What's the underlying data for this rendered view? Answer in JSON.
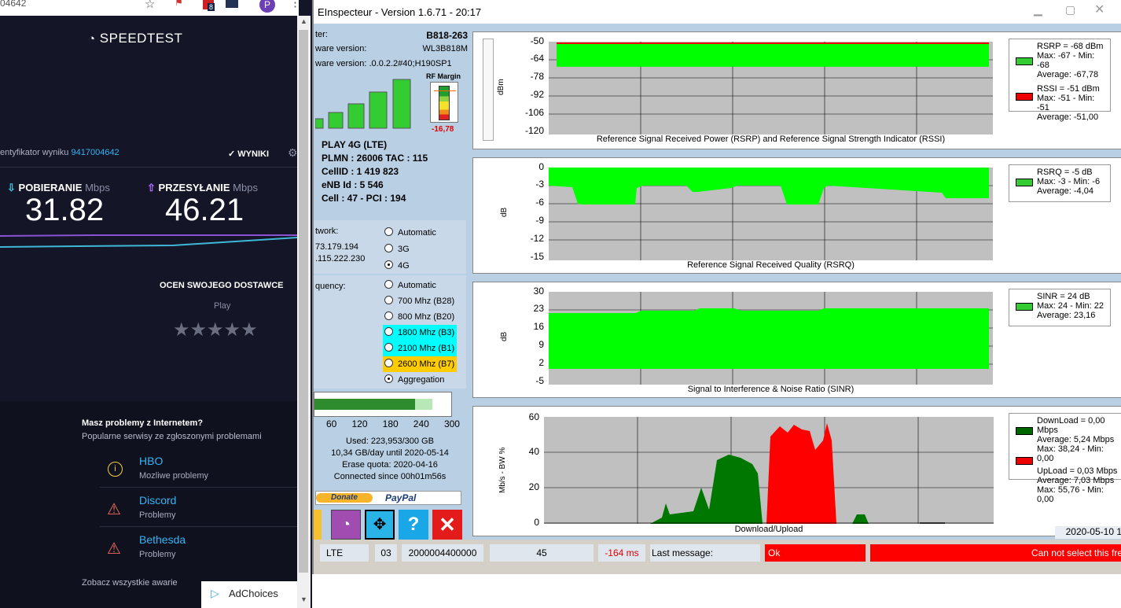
{
  "browser": {
    "url_fragment": "04642",
    "speedtest_logo": "SPEEDTEST",
    "result_id_label": "entyfikator wyniku",
    "result_id": "9417004642",
    "results_button": "WYNIKI",
    "download_label": "POBIERANIE",
    "download_unit": "Mbps",
    "download_value": "31.82",
    "upload_label": "PRZESYŁANIE",
    "upload_unit": "Mbps",
    "upload_value": "46.21",
    "rate_title": "OCEN SWOJEGO DOSTAWCE",
    "provider": "Play",
    "rating_stars": 0,
    "problems_title": "Masz problemy z Internetem?",
    "problems_subtitle": "Popularne serwisy ze zgłoszonymi problemami",
    "issues": [
      {
        "name": "HBO",
        "status": "Mozliwe problemy"
      },
      {
        "name": "Discord",
        "status": "Problemy"
      },
      {
        "name": "Bethesda",
        "status": "Problemy"
      }
    ],
    "see_all": "Zobacz wszystkie awarie",
    "adchoices": "AdChoices",
    "profile_initial": "P",
    "ext_badge": "8"
  },
  "app": {
    "title": "EInspecteur - Version 1.6.71 - 20:17",
    "router_label": "ter:",
    "router_value": "B818-263",
    "hw_label": "ware version:",
    "hw_value": "WL3B818M",
    "sw_label": "ware version:",
    "sw_value": ".0.0.2.2#40;H190SP1",
    "rf_margin_label": "RF Margin",
    "rf_margin_value": "-16,78",
    "net_lines": [
      "PLAY 4G (LTE)",
      "PLMN : 26006 TAC : 115",
      "CellID : 1 419 823",
      "eNB Id : 5 546",
      "Cell : 47 - PCI : 194"
    ],
    "network_label": "twork:",
    "ip1": "73.179.194",
    "ip2": ".115.222.230",
    "network_options": [
      "Automatic",
      "3G",
      "4G"
    ],
    "network_selected": 2,
    "freq_label": "quency:",
    "freq_options": [
      {
        "label": "Automatic",
        "bg": ""
      },
      {
        "label": "700 Mhz (B28)",
        "bg": ""
      },
      {
        "label": "800 Mhz (B20)",
        "bg": ""
      },
      {
        "label": "1800 Mhz (B3)",
        "bg": "#00ffff"
      },
      {
        "label": "2100 Mhz (B1)",
        "bg": "#00ffff"
      },
      {
        "label": "2600 Mhz (B7)",
        "bg": "#ffcc00"
      },
      {
        "label": "Aggregation",
        "bg": ""
      }
    ],
    "freq_selected": 6,
    "usage_ticks": [
      "60",
      "120",
      "180",
      "240",
      "300"
    ],
    "usage_fraction": 0.75,
    "used": "Used: 223,953/300 GB",
    "per_day": "10,34 GB/day until 2020-05-14",
    "erase": "Erase quota: 2020-04-16",
    "connected": "Connected since 00h01m56s",
    "donate": "Donate",
    "paypal": "PayPal",
    "charts": [
      {
        "title": "Reference Signal Received Power (RSRP) and Reference Signal Strength Indicator (RSSI)",
        "ylabel": "dBm",
        "yticks": [
          "-50",
          "-64",
          "-78",
          "-92",
          "-106",
          "-120"
        ],
        "legend": [
          {
            "color": "#33cc33",
            "lines": [
              "RSRP = -68 dBm",
              "Max: -67 - Min: -68",
              "Average: -67,78"
            ]
          },
          {
            "color": "#ee0000",
            "lines": [
              "RSSI = -51 dBm",
              "Max: -51 - Min: -51",
              "Average: -51,00"
            ]
          }
        ]
      },
      {
        "title": "Reference Signal Received Quality (RSRQ)",
        "ylabel": "dB",
        "yticks": [
          "0",
          "-3",
          "-6",
          "-9",
          "-12",
          "-15"
        ],
        "legend": [
          {
            "color": "#33cc33",
            "lines": [
              "RSRQ = -5 dB",
              "Max: -3 - Min: -6",
              "Average: -4,04"
            ]
          }
        ]
      },
      {
        "title": "Signal to Interference & Noise Ratio (SINR)",
        "ylabel": "dB",
        "yticks": [
          "30",
          "23",
          "16",
          "9",
          "2",
          "-5"
        ],
        "legend": [
          {
            "color": "#33cc33",
            "lines": [
              "SINR = 24 dB",
              "Max: 24 - Min: 22",
              "Average: 23,16"
            ]
          }
        ]
      },
      {
        "title": "Download/Upload",
        "ylabel": "Mb/s - BW %",
        "yticks": [
          "60",
          "40",
          "20",
          "0"
        ],
        "legend": [
          {
            "color": "#006600",
            "lines": [
              "DownLoad = 0,00 Mbps",
              "Average: 5,24 Mbps",
              "Max: 38,24 - Min: 0,00"
            ]
          },
          {
            "color": "#ee0000",
            "lines": [
              "UpLoad = 0,03 Mbps",
              "Average: 7,03 Mbps",
              "Max: 55,76 - Min: 0,00"
            ]
          }
        ]
      }
    ],
    "date": "2020-05-10 1",
    "status": {
      "mode": "LTE",
      "code": "03",
      "hex": "2000004400000",
      "num": "45",
      "latency": "-164 ms",
      "last_msg_label": "Last message:",
      "ok": "Ok",
      "error": "Can not select this fre"
    },
    "colors": {
      "signal_green": "#00ff00",
      "upload_red": "#ff0000",
      "download_green": "#006600"
    }
  }
}
